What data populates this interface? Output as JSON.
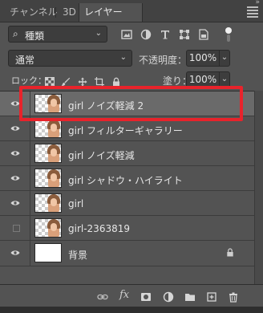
{
  "tabs": [
    {
      "label": "チャンネル",
      "active": false
    },
    {
      "label": "3D",
      "active": false
    },
    {
      "label": "レイヤー",
      "active": true
    }
  ],
  "tab_close": "×",
  "collapse_glyph": "»",
  "filter": {
    "search_glyph": "⌕",
    "label": "種類"
  },
  "blend": {
    "label": "通常"
  },
  "opacity": {
    "label": "不透明度：",
    "value": "100%"
  },
  "lock": {
    "label": "ロック："
  },
  "fill": {
    "label": "塗り：",
    "value": "100%"
  },
  "chevron": "⌄",
  "layers": [
    {
      "name": "girl ノイズ軽減 2",
      "visible": true,
      "selected": true,
      "thumb": "portrait"
    },
    {
      "name": "girl フィルターギャラリー",
      "visible": true,
      "selected": false,
      "thumb": "portrait"
    },
    {
      "name": "girl ノイズ軽減",
      "visible": true,
      "selected": false,
      "thumb": "portrait"
    },
    {
      "name": "girl シャドウ・ハイライト",
      "visible": true,
      "selected": false,
      "thumb": "portrait"
    },
    {
      "name": "girl",
      "visible": true,
      "selected": false,
      "thumb": "portrait"
    },
    {
      "name": "girl-2363819",
      "visible": false,
      "selected": false,
      "thumb": "portrait"
    },
    {
      "name": "背景",
      "visible": true,
      "selected": false,
      "thumb": "white",
      "locked": true
    }
  ],
  "bottom_fx": "fx",
  "colors": {
    "highlight": "#e8232b",
    "panel_bg": "#535353",
    "selected_row": "#6a6a6a"
  }
}
